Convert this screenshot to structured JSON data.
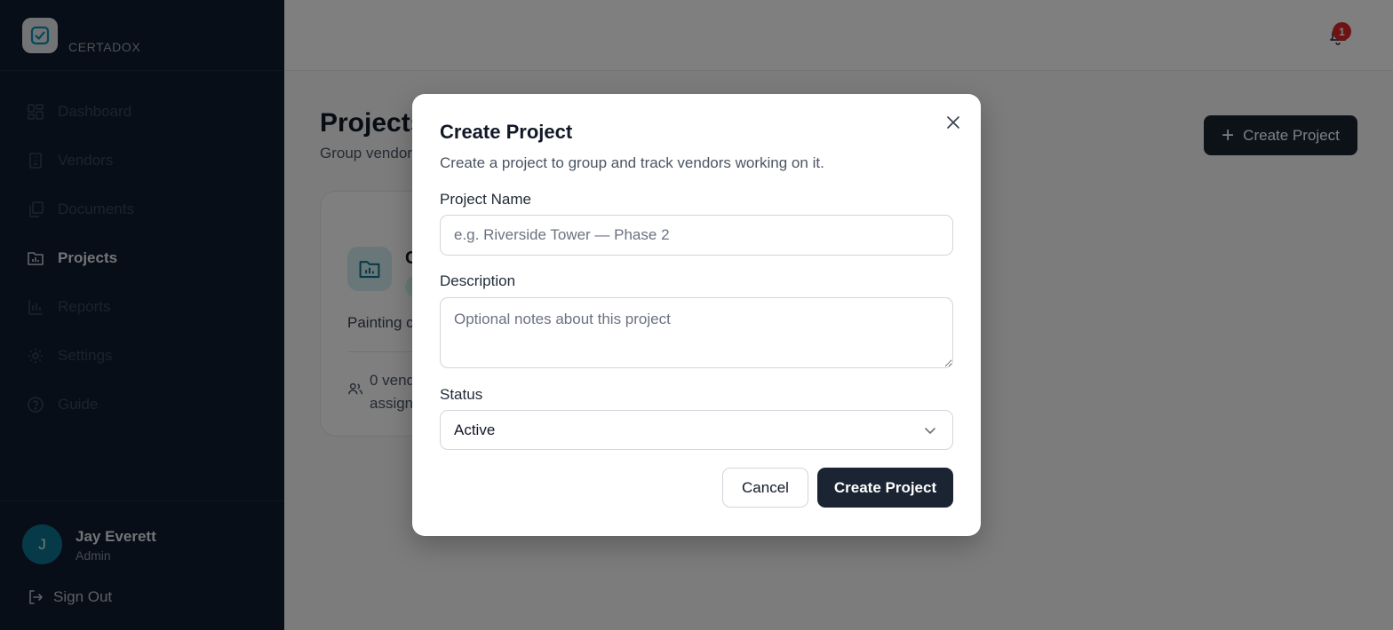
{
  "app": {
    "brand": "CERTADOX"
  },
  "sidebar": {
    "items": [
      {
        "label": "Dashboard",
        "icon": "dashboard-icon"
      },
      {
        "label": "Vendors",
        "icon": "building-icon"
      },
      {
        "label": "Documents",
        "icon": "documents-icon"
      },
      {
        "label": "Projects",
        "icon": "folder-chart-icon",
        "active": true
      },
      {
        "label": "Reports",
        "icon": "bar-chart-icon"
      },
      {
        "label": "Settings",
        "icon": "gear-icon"
      },
      {
        "label": "Guide",
        "icon": "help-circle-icon"
      }
    ],
    "user": {
      "initial": "J",
      "name": "Jay Everett",
      "role": "Admin"
    },
    "signout_label": "Sign Out"
  },
  "header": {
    "notification_count": "1"
  },
  "page": {
    "title": "Projects",
    "subtitle": "Group vendors",
    "create_label": "Create Project"
  },
  "project_card": {
    "title": "C",
    "description": "Painting c",
    "vendors_line1": "0 vend",
    "vendors_line2": "assign"
  },
  "modal": {
    "title": "Create Project",
    "subtitle": "Create a project to group and track vendors working on it.",
    "name_label": "Project Name",
    "name_placeholder": "e.g. Riverside Tower — Phase 2",
    "name_value": "",
    "description_label": "Description",
    "description_placeholder": "Optional notes about this project",
    "description_value": "",
    "status_label": "Status",
    "status_value": "Active",
    "cancel_label": "Cancel",
    "submit_label": "Create Project"
  },
  "colors": {
    "sidebar_bg": "#0f1c2e",
    "primary_button": "#1b2433",
    "badge_red": "#dc2626",
    "avatar_teal": "#0e7490"
  }
}
